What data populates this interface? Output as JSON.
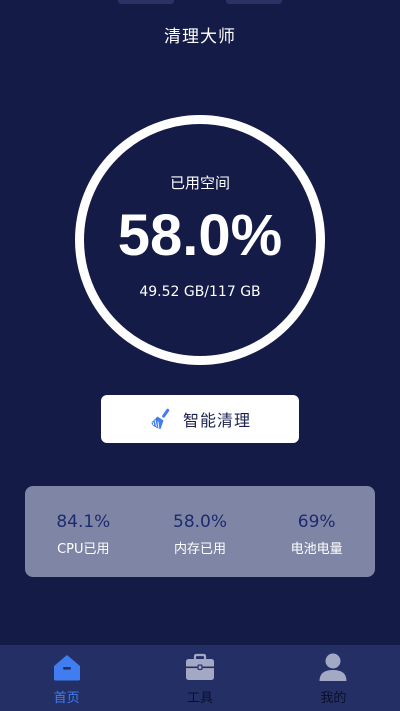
{
  "header": {
    "title": "清理大师"
  },
  "storage": {
    "label": "已用空间",
    "percent": "58.0%",
    "usage": "49.52 GB/117 GB"
  },
  "clean_button": {
    "label": "智能清理",
    "icon": "broom-icon"
  },
  "stats": [
    {
      "value": "84.1%",
      "label": "CPU已用"
    },
    {
      "value": "58.0%",
      "label": "内存已用"
    },
    {
      "value": "69%",
      "label": "电池电量"
    }
  ],
  "tabbar": {
    "items": [
      {
        "label": "首页",
        "icon": "home-icon",
        "active": true
      },
      {
        "label": "工具",
        "icon": "toolbox-icon",
        "active": false
      },
      {
        "label": "我的",
        "icon": "profile-icon",
        "active": false
      }
    ]
  },
  "colors": {
    "background": "#141b47",
    "accent": "#3f7df0",
    "card": "#7f86a5",
    "tabbar": "#242f66"
  }
}
